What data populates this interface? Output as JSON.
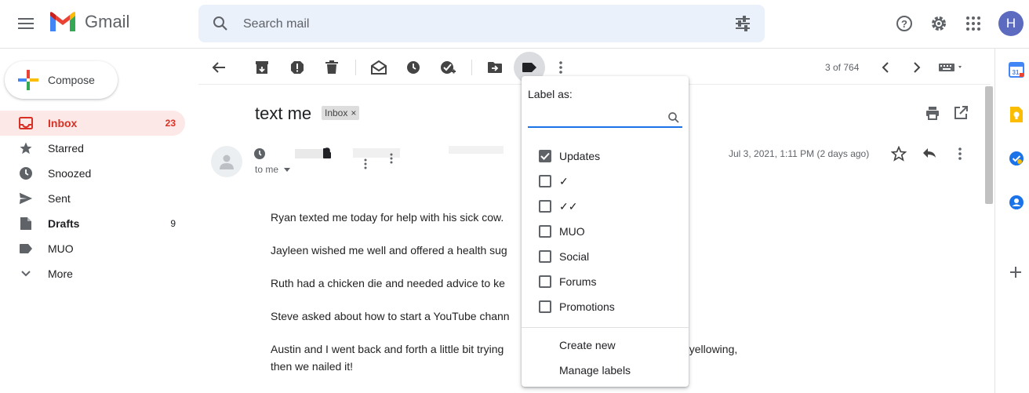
{
  "app": {
    "name": "Gmail"
  },
  "search": {
    "placeholder": "Search mail"
  },
  "user": {
    "initial": "H"
  },
  "compose": {
    "label": "Compose"
  },
  "sidebar": {
    "items": [
      {
        "label": "Inbox",
        "count": "23"
      },
      {
        "label": "Starred",
        "count": ""
      },
      {
        "label": "Snoozed",
        "count": ""
      },
      {
        "label": "Sent",
        "count": ""
      },
      {
        "label": "Drafts",
        "count": "9"
      },
      {
        "label": "MUO",
        "count": ""
      },
      {
        "label": "More",
        "count": ""
      }
    ]
  },
  "toolbar": {
    "pager": "3 of 764"
  },
  "email": {
    "subject": "text me",
    "chip": "Inbox",
    "recipient": "to me",
    "date": "Jul 3, 2021, 1:11 PM (2 days ago)",
    "paragraphs": [
      "Ryan texted me today for help with his sick cow.",
      "Jayleen wished me well and offered a health sug",
      "Ruth had a chicken die and needed advice to ke",
      "Steve asked about how to start a YouTube chann",
      "Austin and I went back and forth a little bit trying                                                    were yellowing, then we nailed it!"
    ]
  },
  "label_menu": {
    "title": "Label as:",
    "options": [
      {
        "label": "Updates",
        "checked": true
      },
      {
        "label": "✓",
        "checked": false
      },
      {
        "label": "✓✓",
        "checked": false
      },
      {
        "label": "MUO",
        "checked": false
      },
      {
        "label": "Social",
        "checked": false
      },
      {
        "label": "Forums",
        "checked": false
      },
      {
        "label": "Promotions",
        "checked": false
      }
    ],
    "create_new": "Create new",
    "manage_labels": "Manage labels"
  },
  "colors": {
    "active": "#d93025",
    "active_bg": "#fce8e6",
    "accent": "#1a73e8",
    "avatar": "#5c6bc0"
  }
}
